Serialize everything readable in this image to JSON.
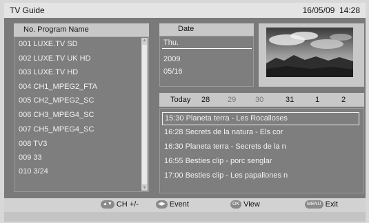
{
  "header": {
    "title": "TV Guide",
    "date": "16/05/09",
    "time": "14:28"
  },
  "program_list": {
    "header": "No. Program Name",
    "items": [
      "001  LUXE.TV SD",
      "002  LUXE.TV UK HD",
      "003  LUXE.TV HD",
      "004  CH1_MPEG2_FTA",
      "005  CH2_MPEG2_SC",
      "006  CH3_MPEG4_SC",
      "007  CH5_MPEG4_SC",
      "008  TV3",
      "009  33",
      "010  3/24"
    ]
  },
  "date_box": {
    "header": "Date",
    "day": "Thu.",
    "year": "2009",
    "month_day": "05/16"
  },
  "date_tabs": [
    {
      "label": "Today",
      "dim": false
    },
    {
      "label": "28",
      "dim": false
    },
    {
      "label": "29",
      "dim": true
    },
    {
      "label": "30",
      "dim": true
    },
    {
      "label": "31",
      "dim": false
    },
    {
      "label": "1",
      "dim": false
    },
    {
      "label": "2",
      "dim": false
    }
  ],
  "events": [
    "15:30  Planeta terra - Les Rocalloses",
    "16:28  Secrets de la natura - Els cor",
    "16:30  Planeta terra - Secrets de la n",
    "16:55  Besties clip - porc senglar",
    "17:00  Besties clip - Les papallones n"
  ],
  "footer": {
    "ch_key": "▲▼",
    "ch_label": "CH +/-",
    "event_key": "◀▶",
    "event_label": "Event",
    "ok_key": "OK",
    "ok_label": "View",
    "menu_key": "MENU",
    "menu_label": "Exit"
  },
  "preview": {
    "icon": "landscape-image"
  }
}
